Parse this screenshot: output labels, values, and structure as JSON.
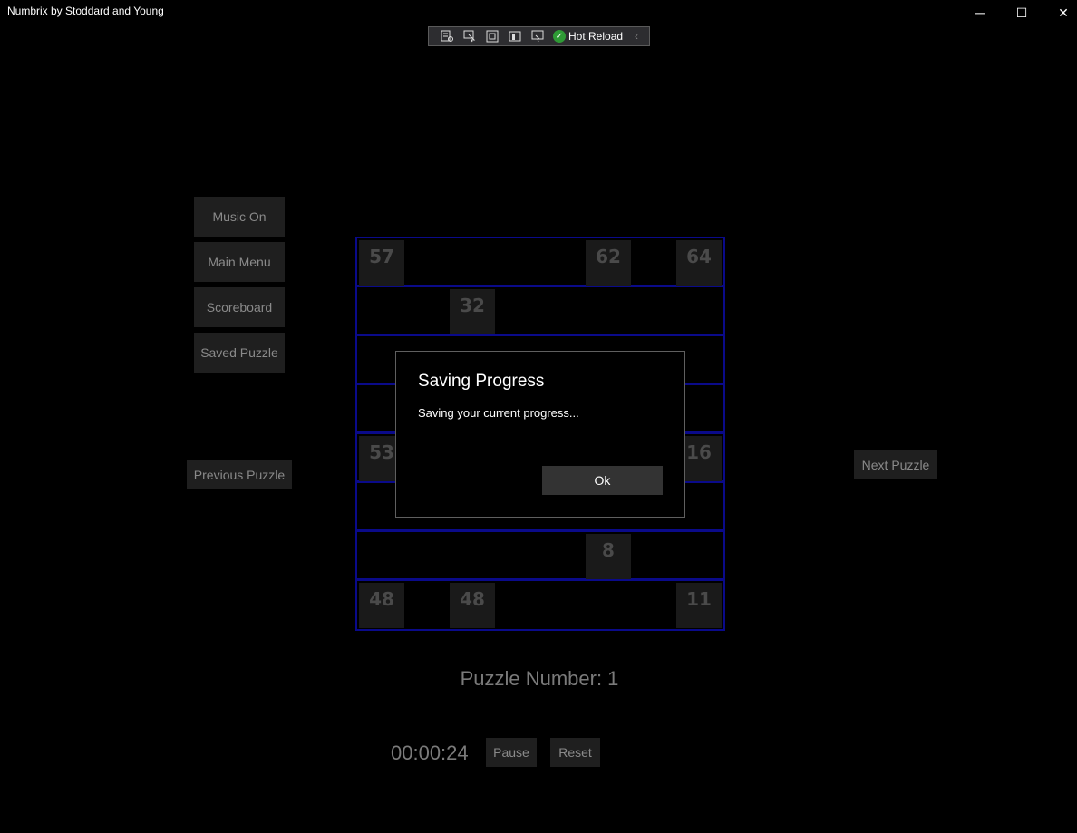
{
  "window": {
    "title": "Numbrix by Stoddard and Young",
    "minimize_glyph": "─",
    "maximize_glyph": "☐",
    "close_glyph": "✕"
  },
  "debug_toolbar": {
    "hot_reload_label": "Hot Reload",
    "status": "ok",
    "collapse_glyph": "‹"
  },
  "side_menu": {
    "music": "Music On",
    "main_menu": "Main Menu",
    "scoreboard": "Scoreboard",
    "saved_puzzle": "Saved Puzzle"
  },
  "navigation": {
    "previous": "Previous Puzzle",
    "next": "Next Puzzle"
  },
  "board": {
    "cells": [
      {
        "row": 0,
        "col": 0,
        "value": "57"
      },
      {
        "row": 0,
        "col": 5,
        "value": "62"
      },
      {
        "row": 0,
        "col": 7,
        "value": "64"
      },
      {
        "row": 1,
        "col": 2,
        "value": "32"
      },
      {
        "row": 4,
        "col": 0,
        "value": "53"
      },
      {
        "row": 4,
        "col": 7,
        "value": "16"
      },
      {
        "row": 6,
        "col": 5,
        "value": "8"
      },
      {
        "row": 7,
        "col": 0,
        "value": "48"
      },
      {
        "row": 7,
        "col": 2,
        "value": "48"
      },
      {
        "row": 7,
        "col": 7,
        "value": "11"
      }
    ]
  },
  "status": {
    "puzzle_number": "Puzzle Number: 1",
    "timer": "00:00:24",
    "pause": "Pause",
    "reset": "Reset"
  },
  "dialog": {
    "title": "Saving Progress",
    "message": "Saving your current progress...",
    "ok": "Ok"
  },
  "colors": {
    "grid_border": "#0a0a8a",
    "cell_bg": "#1a1a1a",
    "cell_text": "#4a4a4a",
    "button_bg": "#1f1f1f",
    "button_text": "#8a8a8a"
  }
}
